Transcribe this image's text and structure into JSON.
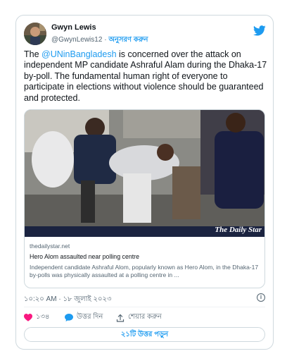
{
  "tweet": {
    "author_name": "Gwyn Lewis",
    "author_handle": "@GwynLewis12",
    "separator": "·",
    "follow_label": "অনুসরণ করুন",
    "text_pre": "The ",
    "mention": "@UNinBangladesh",
    "text_post": " is concerned over the attack on independent MP candidate Ashraful Alam during the Dhaka-17 by-poll. The fundamental human right of everyone to participate in elections without violence should be guaranteed and protected.",
    "time": "১০:২০ AM · ১৮ জুলাই ২০২৩",
    "like_count": "১৩৪",
    "reply_label": "উত্তর দিন",
    "share_label": "শেয়ার করুন",
    "read_replies_label": "২১টি উত্তর পড়ুন"
  },
  "link_card": {
    "watermark": "The Daily Star",
    "domain": "thedailystar.net",
    "title": "Hero Alom assaulted near polling centre",
    "description": "Independent candidate Ashraful Alom, popularly known as Hero Alom, in the Dhaka-17 by-polls was physically assaulted at a polling centre in ..."
  },
  "colors": {
    "accent": "#1d9bf0",
    "like": "#f91880",
    "muted": "#536471",
    "border": "#cfd9de"
  },
  "icons": {
    "brand": "twitter-bird-icon",
    "like": "heart-icon",
    "reply": "speech-bubble-icon",
    "share": "share-upload-icon",
    "info": "info-icon"
  }
}
